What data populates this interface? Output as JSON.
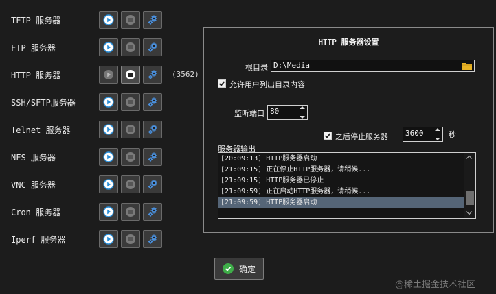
{
  "servers": [
    {
      "label": "TFTP 服务器",
      "running": false,
      "pid": ""
    },
    {
      "label": "FTP 服务器",
      "running": false,
      "pid": ""
    },
    {
      "label": "HTTP 服务器",
      "running": true,
      "pid": "(3562)"
    },
    {
      "label": "SSH/SFTP服务器",
      "running": false,
      "pid": ""
    },
    {
      "label": "Telnet 服务器",
      "running": false,
      "pid": ""
    },
    {
      "label": "NFS 服务器",
      "running": false,
      "pid": ""
    },
    {
      "label": "VNC 服务器",
      "running": false,
      "pid": ""
    },
    {
      "label": "Cron 服务器",
      "running": false,
      "pid": ""
    },
    {
      "label": "Iperf 服务器",
      "running": false,
      "pid": ""
    }
  ],
  "panel": {
    "title": "HTTP 服务器设置",
    "root_label": "根目录",
    "root_value": "D:\\Media",
    "allow_list_label": "允许用户列出目录内容",
    "allow_list_checked": true,
    "port_label": "监听端口",
    "port_value": "80",
    "stop_after_label": "之后停止服务器",
    "stop_after_checked": true,
    "stop_after_value": "3600",
    "stop_after_unit": "秒",
    "output_label": "服务器输出",
    "log": [
      "[20:09:13] HTTP服务器启动",
      "[21:09:15] 正在停止HTTP服务器，请稍候...",
      "[21:09:15] HTTP服务器已停止",
      "[21:09:59] 正在启动HTTP服务器，请稍候...",
      "[21:09:59] HTTP服务器启动"
    ],
    "log_selected_index": 4
  },
  "ok_label": "确定",
  "watermark": "@稀土掘金技术社区",
  "colors": {
    "background": "#1c1c1c",
    "play_blue": "#2a8fd9",
    "gear_blue": "#4a8fdc",
    "ok_green": "#3fae49",
    "folder_yellow": "#e8b325",
    "selection": "#556577"
  },
  "icons": [
    "play-icon",
    "stop-icon",
    "gear-icon",
    "folder-icon",
    "check-icon"
  ]
}
